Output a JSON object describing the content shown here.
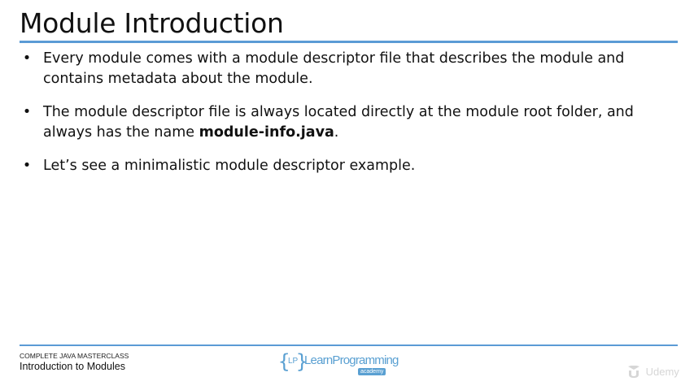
{
  "slide": {
    "title": "Module Introduction",
    "bullets": [
      {
        "text": "Every module comes with a module descriptor file that describes the module and contains metadata about the module.",
        "after": ""
      },
      {
        "text": "The module descriptor file is always located directly at the module root folder, and always has the name ",
        "bold": "module-info.java",
        "after": "."
      },
      {
        "text": "Let’s see a minimalistic module descriptor example.",
        "after": ""
      }
    ],
    "bullet_glyph": "•"
  },
  "footer": {
    "course": "COMPLETE JAVA MASTERCLASS",
    "section": "Introduction to Modules",
    "logo": {
      "bracket_left": "{",
      "initials": "LP",
      "bracket_right": "}",
      "wordmark": "LearnProgramming",
      "tagline": "academy"
    },
    "watermark": "Udemy"
  },
  "colors": {
    "accent_rule": "#5b9bd5",
    "logo_blue": "#5aa0d2",
    "watermark": "#d6d6d6"
  }
}
